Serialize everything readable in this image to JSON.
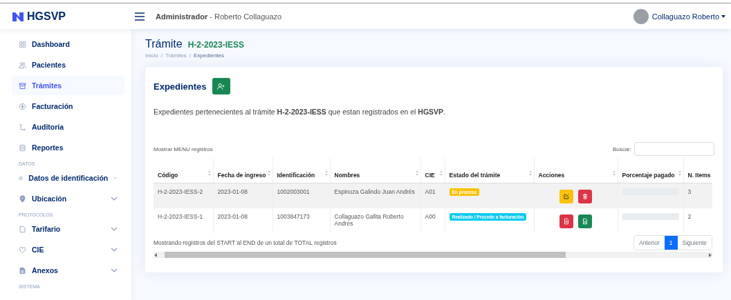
{
  "brand": {
    "name": "HGSVP"
  },
  "header": {
    "role": "Administrador",
    "user_suffix": "- Roberto Collaguazo",
    "profile_name": "Collaguazo Roberto"
  },
  "sidebar": {
    "items": [
      {
        "kind": "item",
        "label": "Dashboard",
        "selected": false
      },
      {
        "kind": "item",
        "label": "Pacientes",
        "selected": false
      },
      {
        "kind": "item",
        "label": "Trámites",
        "selected": true
      },
      {
        "kind": "item",
        "label": "Facturación",
        "selected": false
      },
      {
        "kind": "item",
        "label": "Auditoría",
        "selected": false
      },
      {
        "kind": "item",
        "label": "Reportes",
        "selected": false
      },
      {
        "kind": "heading",
        "label": "DATOS"
      },
      {
        "kind": "item",
        "label": "Datos de identificación",
        "selected": false,
        "expanded": false
      },
      {
        "kind": "item",
        "label": "Ubicación",
        "selected": false,
        "expanded": false
      },
      {
        "kind": "heading",
        "label": "PROTOCOLOS"
      },
      {
        "kind": "item",
        "label": "Tarifario",
        "selected": false,
        "expanded": false
      },
      {
        "kind": "item",
        "label": "CIE",
        "selected": false,
        "expanded": false
      },
      {
        "kind": "item",
        "label": "Anexos",
        "selected": false,
        "expanded": false
      },
      {
        "kind": "heading",
        "label": "SISTEMA"
      }
    ]
  },
  "page": {
    "title": "Trámite",
    "code": "H-2-2023-IESS",
    "breadcrumb_separator": "/",
    "breadcrumb": [
      {
        "label": "Inicio",
        "current": false
      },
      {
        "label": "Trámites",
        "current": false
      },
      {
        "label": "Expedientes",
        "current": true
      }
    ]
  },
  "card": {
    "title": "Expedientes",
    "description": "Expedientes pertenecientes al trámite **H-2-2023-IESS** que estan registrados en el **HGSVP**.",
    "length_label": "Mostrar MENU registros",
    "search_label": "Buscar:",
    "table": {
      "columns": [
        "Código",
        "Fecha de ingreso",
        "Identificación",
        "Nombres",
        "CIE",
        "Estado del trámite",
        "Acciones",
        "Porcentaje pagado",
        "N. Items"
      ],
      "rows": [
        {
          "code": "H-2-2023-IESS-2",
          "date": "2023-01-08",
          "id": "1002003001",
          "name": "Espinoza Galindo Juan Andrés",
          "cie": "A01",
          "status": "En proceso",
          "color": "#ffc107",
          "actions": [
            {
              "kind": "edit"
            },
            {
              "kind": "delete"
            }
          ],
          "level": 0,
          "items": "3"
        },
        {
          "code": "H-2-2023-IESS-1",
          "date": "2023-01-08",
          "id": "1003847173",
          "name": "Collaguazo Gafita Roberto Andrés",
          "cie": "A00",
          "status": "Realizado / Procede a facturación",
          "color": "#0dcaf0",
          "actions": [
            {
              "kind": "pdf"
            },
            {
              "kind": "excel"
            }
          ],
          "level": 0,
          "items": "2"
        }
      ]
    },
    "info": "Mostrando registros del START al END de un total de TOTAL registros",
    "pagination": [
      {
        "label": "Anterior",
        "selected": false
      },
      {
        "label": "1",
        "selected": true
      },
      {
        "label": "Siguiente",
        "selected": false
      }
    ]
  }
}
